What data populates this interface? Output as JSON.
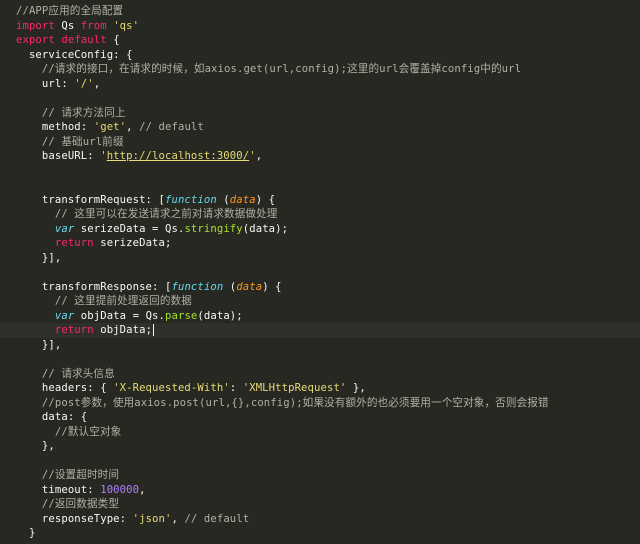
{
  "editor": {
    "lines": [
      {
        "highlight": false,
        "tokens": [
          {
            "t": "comment",
            "v": "//APP应用的全局配置"
          }
        ]
      },
      {
        "highlight": false,
        "tokens": [
          {
            "t": "kw",
            "v": "import"
          },
          {
            "t": "plain",
            "v": " Qs "
          },
          {
            "t": "kw",
            "v": "from"
          },
          {
            "t": "plain",
            "v": " "
          },
          {
            "t": "str",
            "v": "'qs'"
          }
        ]
      },
      {
        "highlight": false,
        "tokens": [
          {
            "t": "kw",
            "v": "export"
          },
          {
            "t": "plain",
            "v": " "
          },
          {
            "t": "kw",
            "v": "default"
          },
          {
            "t": "plain",
            "v": " {"
          }
        ]
      },
      {
        "highlight": false,
        "tokens": [
          {
            "t": "plain",
            "v": "  serviceConfig: {"
          }
        ]
      },
      {
        "highlight": false,
        "tokens": [
          {
            "t": "comment",
            "v": "    //请求的接口，在请求的时候，如axios.get(url,config);这里的url会覆盖掉config中的url"
          }
        ]
      },
      {
        "highlight": false,
        "tokens": [
          {
            "t": "plain",
            "v": "    url: "
          },
          {
            "t": "str",
            "v": "'/'"
          },
          {
            "t": "plain",
            "v": ","
          }
        ]
      },
      {
        "highlight": false,
        "tokens": [
          {
            "t": "plain",
            "v": ""
          }
        ]
      },
      {
        "highlight": false,
        "tokens": [
          {
            "t": "comment",
            "v": "    // 请求方法同上"
          }
        ]
      },
      {
        "highlight": false,
        "tokens": [
          {
            "t": "plain",
            "v": "    method: "
          },
          {
            "t": "str",
            "v": "'get'"
          },
          {
            "t": "plain",
            "v": ", "
          },
          {
            "t": "comment",
            "v": "// default"
          }
        ]
      },
      {
        "highlight": false,
        "tokens": [
          {
            "t": "comment",
            "v": "    // 基础url前缀"
          }
        ]
      },
      {
        "highlight": false,
        "tokens": [
          {
            "t": "plain",
            "v": "    baseURL: "
          },
          {
            "t": "str",
            "v": "'"
          },
          {
            "t": "url",
            "v": "http://localhost:3000/"
          },
          {
            "t": "str",
            "v": "'"
          },
          {
            "t": "plain",
            "v": ","
          }
        ]
      },
      {
        "highlight": false,
        "tokens": [
          {
            "t": "plain",
            "v": ""
          }
        ]
      },
      {
        "highlight": false,
        "tokens": [
          {
            "t": "plain",
            "v": ""
          }
        ]
      },
      {
        "highlight": false,
        "tokens": [
          {
            "t": "plain",
            "v": "    transformRequest: ["
          },
          {
            "t": "var",
            "v": "function"
          },
          {
            "t": "plain",
            "v": " ("
          },
          {
            "t": "param",
            "v": "data"
          },
          {
            "t": "plain",
            "v": ") {"
          }
        ]
      },
      {
        "highlight": false,
        "tokens": [
          {
            "t": "comment",
            "v": "      // 这里可以在发送请求之前对请求数据做处理"
          }
        ]
      },
      {
        "highlight": false,
        "tokens": [
          {
            "t": "plain",
            "v": "      "
          },
          {
            "t": "var",
            "v": "var"
          },
          {
            "t": "plain",
            "v": " serizeData = Qs."
          },
          {
            "t": "func",
            "v": "stringify"
          },
          {
            "t": "plain",
            "v": "(data);"
          }
        ]
      },
      {
        "highlight": false,
        "tokens": [
          {
            "t": "plain",
            "v": "      "
          },
          {
            "t": "kw",
            "v": "return"
          },
          {
            "t": "plain",
            "v": " serizeData;"
          }
        ]
      },
      {
        "highlight": false,
        "tokens": [
          {
            "t": "plain",
            "v": "    }],"
          }
        ]
      },
      {
        "highlight": false,
        "tokens": [
          {
            "t": "plain",
            "v": ""
          }
        ]
      },
      {
        "highlight": false,
        "tokens": [
          {
            "t": "plain",
            "v": "    transformResponse: ["
          },
          {
            "t": "var",
            "v": "function"
          },
          {
            "t": "plain",
            "v": " ("
          },
          {
            "t": "param",
            "v": "data"
          },
          {
            "t": "plain",
            "v": ") {"
          }
        ]
      },
      {
        "highlight": false,
        "tokens": [
          {
            "t": "comment",
            "v": "      // 这里提前处理返回的数据"
          }
        ]
      },
      {
        "highlight": false,
        "tokens": [
          {
            "t": "plain",
            "v": "      "
          },
          {
            "t": "var",
            "v": "var"
          },
          {
            "t": "plain",
            "v": " objData = Qs."
          },
          {
            "t": "func",
            "v": "parse"
          },
          {
            "t": "plain",
            "v": "(data);"
          }
        ]
      },
      {
        "highlight": true,
        "cursor": true,
        "tokens": [
          {
            "t": "plain",
            "v": "      "
          },
          {
            "t": "kw",
            "v": "return"
          },
          {
            "t": "plain",
            "v": " objData;"
          }
        ]
      },
      {
        "highlight": false,
        "tokens": [
          {
            "t": "plain",
            "v": "    }],"
          }
        ]
      },
      {
        "highlight": false,
        "tokens": [
          {
            "t": "plain",
            "v": ""
          }
        ]
      },
      {
        "highlight": false,
        "tokens": [
          {
            "t": "comment",
            "v": "    // 请求头信息"
          }
        ]
      },
      {
        "highlight": false,
        "tokens": [
          {
            "t": "plain",
            "v": "    headers: { "
          },
          {
            "t": "str",
            "v": "'X-Requested-With'"
          },
          {
            "t": "plain",
            "v": ": "
          },
          {
            "t": "str",
            "v": "'XMLHttpRequest'"
          },
          {
            "t": "plain",
            "v": " },"
          }
        ]
      },
      {
        "highlight": false,
        "tokens": [
          {
            "t": "comment",
            "v": "    //post参数，使用axios.post(url,{},config);如果没有额外的也必须要用一个空对象，否则会报错"
          }
        ]
      },
      {
        "highlight": false,
        "tokens": [
          {
            "t": "plain",
            "v": "    data: {"
          }
        ]
      },
      {
        "highlight": false,
        "tokens": [
          {
            "t": "comment",
            "v": "      //默认空对象"
          }
        ]
      },
      {
        "highlight": false,
        "tokens": [
          {
            "t": "plain",
            "v": "    },"
          }
        ]
      },
      {
        "highlight": false,
        "tokens": [
          {
            "t": "plain",
            "v": ""
          }
        ]
      },
      {
        "highlight": false,
        "tokens": [
          {
            "t": "comment",
            "v": "    //设置超时时间"
          }
        ]
      },
      {
        "highlight": false,
        "tokens": [
          {
            "t": "plain",
            "v": "    timeout: "
          },
          {
            "t": "num",
            "v": "100000"
          },
          {
            "t": "plain",
            "v": ","
          }
        ]
      },
      {
        "highlight": false,
        "tokens": [
          {
            "t": "comment",
            "v": "    //返回数据类型"
          }
        ]
      },
      {
        "highlight": false,
        "tokens": [
          {
            "t": "plain",
            "v": "    responseType: "
          },
          {
            "t": "str",
            "v": "'json'"
          },
          {
            "t": "plain",
            "v": ", "
          },
          {
            "t": "comment",
            "v": "// default"
          }
        ]
      },
      {
        "highlight": false,
        "tokens": [
          {
            "t": "plain",
            "v": "  }"
          }
        ]
      }
    ]
  },
  "colors": {
    "background": "#272822",
    "comment": "#b0b0a6",
    "keyword": "#f92672",
    "string": "#e6db74",
    "number": "#ae81ff",
    "function": "#a6e22e",
    "storage": "#66d9ef",
    "parameter": "#fd971f"
  }
}
